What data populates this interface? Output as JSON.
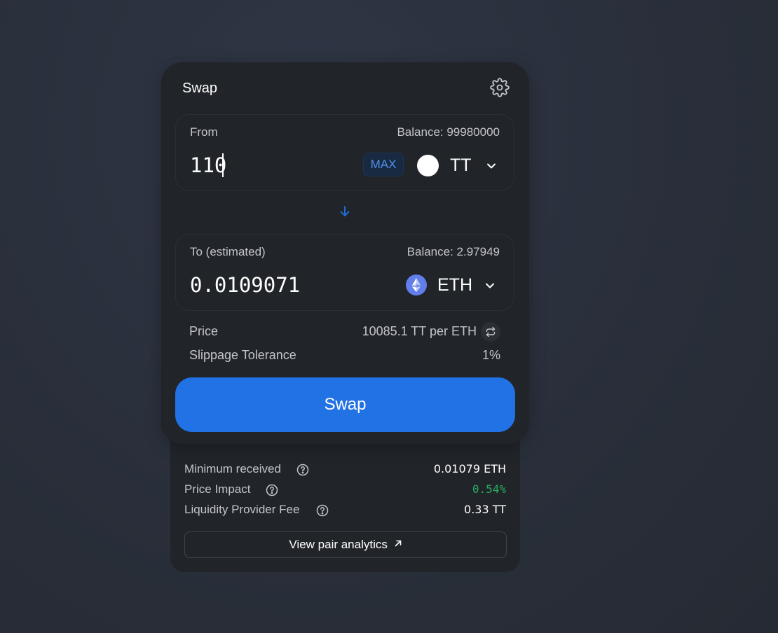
{
  "swap_card": {
    "title": "Swap",
    "settings_icon": "gear-icon"
  },
  "from_panel": {
    "label": "From",
    "balance": "Balance: 99980000",
    "amount": "110",
    "max_label": "MAX",
    "token_symbol": "TT",
    "token_icon": "white-token-circle-icon"
  },
  "to_panel": {
    "label": "To (estimated)",
    "balance": "Balance: 2.97949",
    "amount": "0.0109071",
    "token_symbol": "ETH",
    "token_icon": "eth-logo-icon"
  },
  "price": {
    "label": "Price",
    "value": "10085.1 TT per ETH"
  },
  "slippage": {
    "label": "Slippage Tolerance",
    "value": "1%"
  },
  "swap_button": {
    "label": "Swap"
  },
  "details": {
    "minimum_received": {
      "label": "Minimum received",
      "value": "0.01079 ETH"
    },
    "price_impact": {
      "label": "Price Impact",
      "value": "0.54%"
    },
    "lp_fee": {
      "label": "Liquidity Provider Fee",
      "value": "0.33 TT"
    },
    "analytics_label": "View pair analytics"
  },
  "colors": {
    "background": "#2a303c",
    "card": "#212429",
    "accent_blue": "#2172e5",
    "positive_green": "#27ae60",
    "eth_purple": "#627eea"
  }
}
